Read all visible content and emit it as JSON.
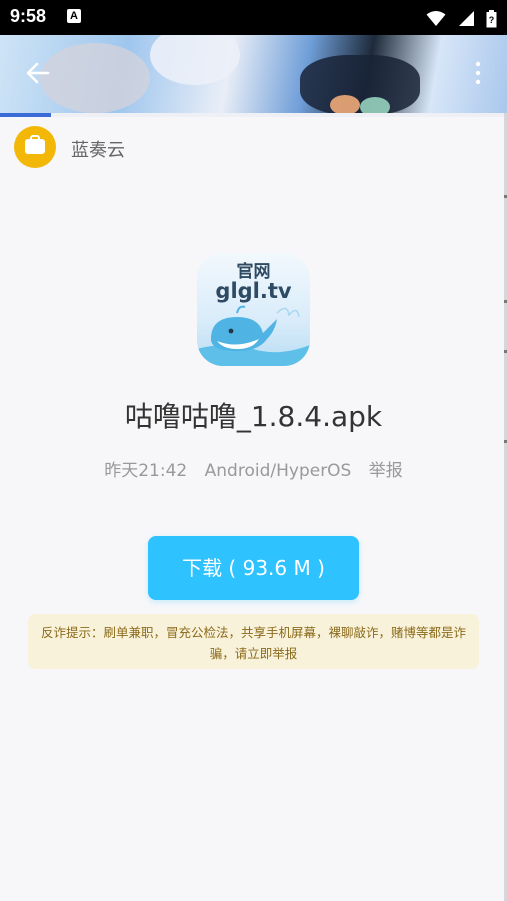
{
  "status_bar": {
    "time": "9:58",
    "notification_icon": "A",
    "icons": [
      "wifi-icon",
      "signal-icon",
      "battery-icon"
    ]
  },
  "banner": {
    "back_icon": "arrow-left-icon",
    "more_icon": "more-vertical-icon"
  },
  "loading_progress": 0.1,
  "site": {
    "logo_icon": "briefcase-icon",
    "name": "蓝奏云",
    "logo_color": "#f2b707"
  },
  "app": {
    "icon_line1": "官网",
    "icon_line2": "glgl.tv",
    "icon_image": "whale-icon",
    "file_name": "咕噜咕噜_1.8.4.apk"
  },
  "meta": {
    "time": "昨天21:42",
    "platform": "Android/HyperOS",
    "report": "举报"
  },
  "download": {
    "label": "下载 ( 93.6 M )",
    "color": "#2ec2ff"
  },
  "warning": {
    "text": "反诈提示：刷单兼职，冒充公检法，共享手机屏幕，裸聊敲诈，赌博等都是诈骗，请立即举报"
  }
}
